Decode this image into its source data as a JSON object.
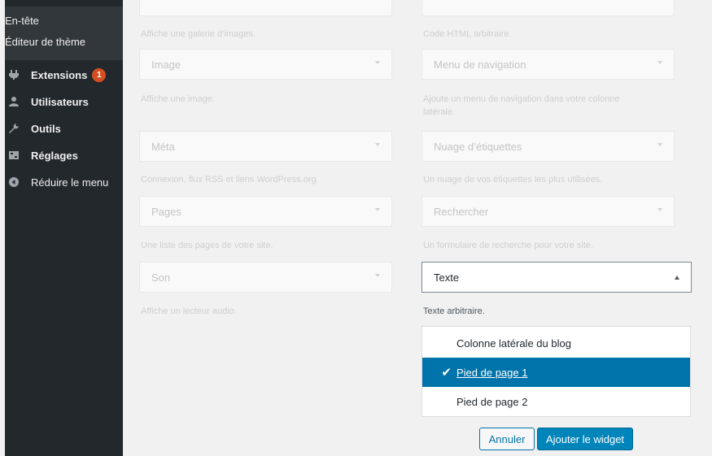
{
  "sidebar": {
    "submenu": [
      "En-tête",
      "Éditeur de thème"
    ],
    "items": [
      {
        "label": "Extensions",
        "icon": "plugin-icon",
        "badge": "1"
      },
      {
        "label": "Utilisateurs",
        "icon": "users-icon"
      },
      {
        "label": "Outils",
        "icon": "tools-icon"
      },
      {
        "label": "Réglages",
        "icon": "settings-icon"
      },
      {
        "label": "Réduire le menu",
        "icon": "collapse-icon"
      }
    ]
  },
  "widgets": {
    "left": [
      {
        "title": "",
        "desc": "Affiche une galerie d’images."
      },
      {
        "title": "Image",
        "desc": "Affiche une image."
      },
      {
        "title": "Méta",
        "desc": "Connexion, flux RSS et liens WordPress.org."
      },
      {
        "title": "Pages",
        "desc": "Une liste des pages de votre site."
      },
      {
        "title": "Son",
        "desc": "Affiche un lecteur audio."
      }
    ],
    "right": [
      {
        "title": "",
        "desc": "Code HTML arbitraire."
      },
      {
        "title": "Menu de navigation",
        "desc": "Ajoute un menu de navigation dans votre colonne latérale."
      },
      {
        "title": "Nuage d’étiquettes",
        "desc": "Un nuage de vos étiquettes les plus utilisées."
      },
      {
        "title": "Rechercher",
        "desc": "Un formulaire de recherche pour votre site."
      },
      {
        "title": "Texte",
        "desc": "Texte arbitraire."
      }
    ]
  },
  "dropdown": {
    "options": [
      "Colonne latérale du blog",
      "Pied de page 1",
      "Pied de page 2"
    ],
    "selected": "Pied de page 1"
  },
  "buttons": {
    "cancel": "Annuler",
    "add": "Ajouter le widget"
  },
  "colors": {
    "sidebar": "#23282d",
    "accent": "#0073aa",
    "badge": "#d54e21"
  }
}
